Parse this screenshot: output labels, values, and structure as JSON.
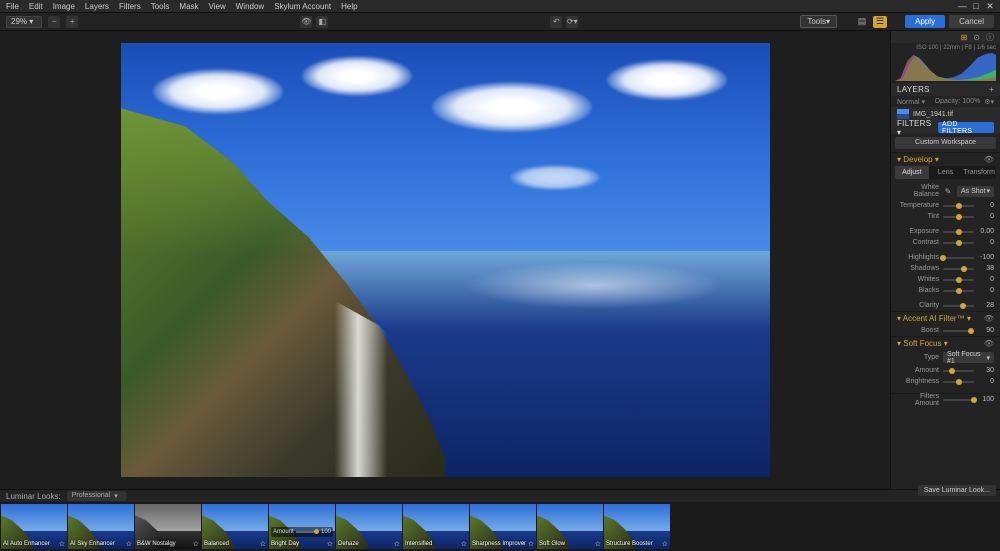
{
  "menu": {
    "items": [
      "File",
      "Edit",
      "Image",
      "Layers",
      "Filters",
      "Tools",
      "Mask",
      "View",
      "Window",
      "Skylum Account",
      "Help"
    ]
  },
  "toolbar": {
    "zoom": "29%",
    "tools": "Tools",
    "apply": "Apply",
    "cancel": "Cancel"
  },
  "sidebar": {
    "histo_meta": "ISO 100 | 22mm | F8 | 1/6 sec",
    "layers_hdr": "Layers",
    "blend": "Normal",
    "opacity": "Opacity: 100%",
    "layer_name": "IMG_1941.tif",
    "filters_hdr": "Filters",
    "add_filters": "Add Filters",
    "workspace": "Custom Workspace",
    "develop": {
      "title": "Develop",
      "tabs": [
        "Adjust",
        "Lens",
        "Transform"
      ],
      "wb_label": "White Balance",
      "wb_value": "As Shot",
      "sliders": [
        {
          "label": "Temperature",
          "val": "0",
          "pos": 50
        },
        {
          "label": "Tint",
          "val": "0",
          "pos": 50
        },
        {
          "label": "Exposure",
          "val": "0.00",
          "pos": 50
        },
        {
          "label": "Contrast",
          "val": "0",
          "pos": 50
        },
        {
          "label": "Highlights",
          "val": "-100",
          "pos": 0
        },
        {
          "label": "Shadows",
          "val": "38",
          "pos": 69
        },
        {
          "label": "Whites",
          "val": "0",
          "pos": 50
        },
        {
          "label": "Blacks",
          "val": "0",
          "pos": 50
        },
        {
          "label": "Clarity",
          "val": "28",
          "pos": 64
        }
      ]
    },
    "accent": {
      "title": "Accent AI Filter™",
      "sliders": [
        {
          "label": "Boost",
          "val": "90",
          "pos": 90
        }
      ]
    },
    "soft": {
      "title": "Soft Focus",
      "type_label": "Type",
      "type_value": "Soft Focus #1",
      "sliders": [
        {
          "label": "Amount",
          "val": "30",
          "pos": 30
        },
        {
          "label": "Brightness",
          "val": "0",
          "pos": 50
        }
      ]
    },
    "filters_amt": {
      "label": "Filters Amount",
      "val": "100",
      "pos": 100
    }
  },
  "looks": {
    "label": "Luminar Looks:",
    "preset": "Professional",
    "save": "Save Luminar Look...",
    "amt_label": "Amount",
    "amt_val": "100",
    "items": [
      {
        "name": "AI Auto Enhancer",
        "bw": false
      },
      {
        "name": "AI Sky Enhancer",
        "bw": false
      },
      {
        "name": "B&W Nostalgy",
        "bw": true
      },
      {
        "name": "Balanced",
        "bw": false
      },
      {
        "name": "Bright Day",
        "bw": false,
        "sel": true
      },
      {
        "name": "Dehaze",
        "bw": false
      },
      {
        "name": "Intensified",
        "bw": false
      },
      {
        "name": "Sharpness Improver",
        "bw": false
      },
      {
        "name": "Soft Glow",
        "bw": false
      },
      {
        "name": "Structure Booster",
        "bw": false
      }
    ]
  }
}
